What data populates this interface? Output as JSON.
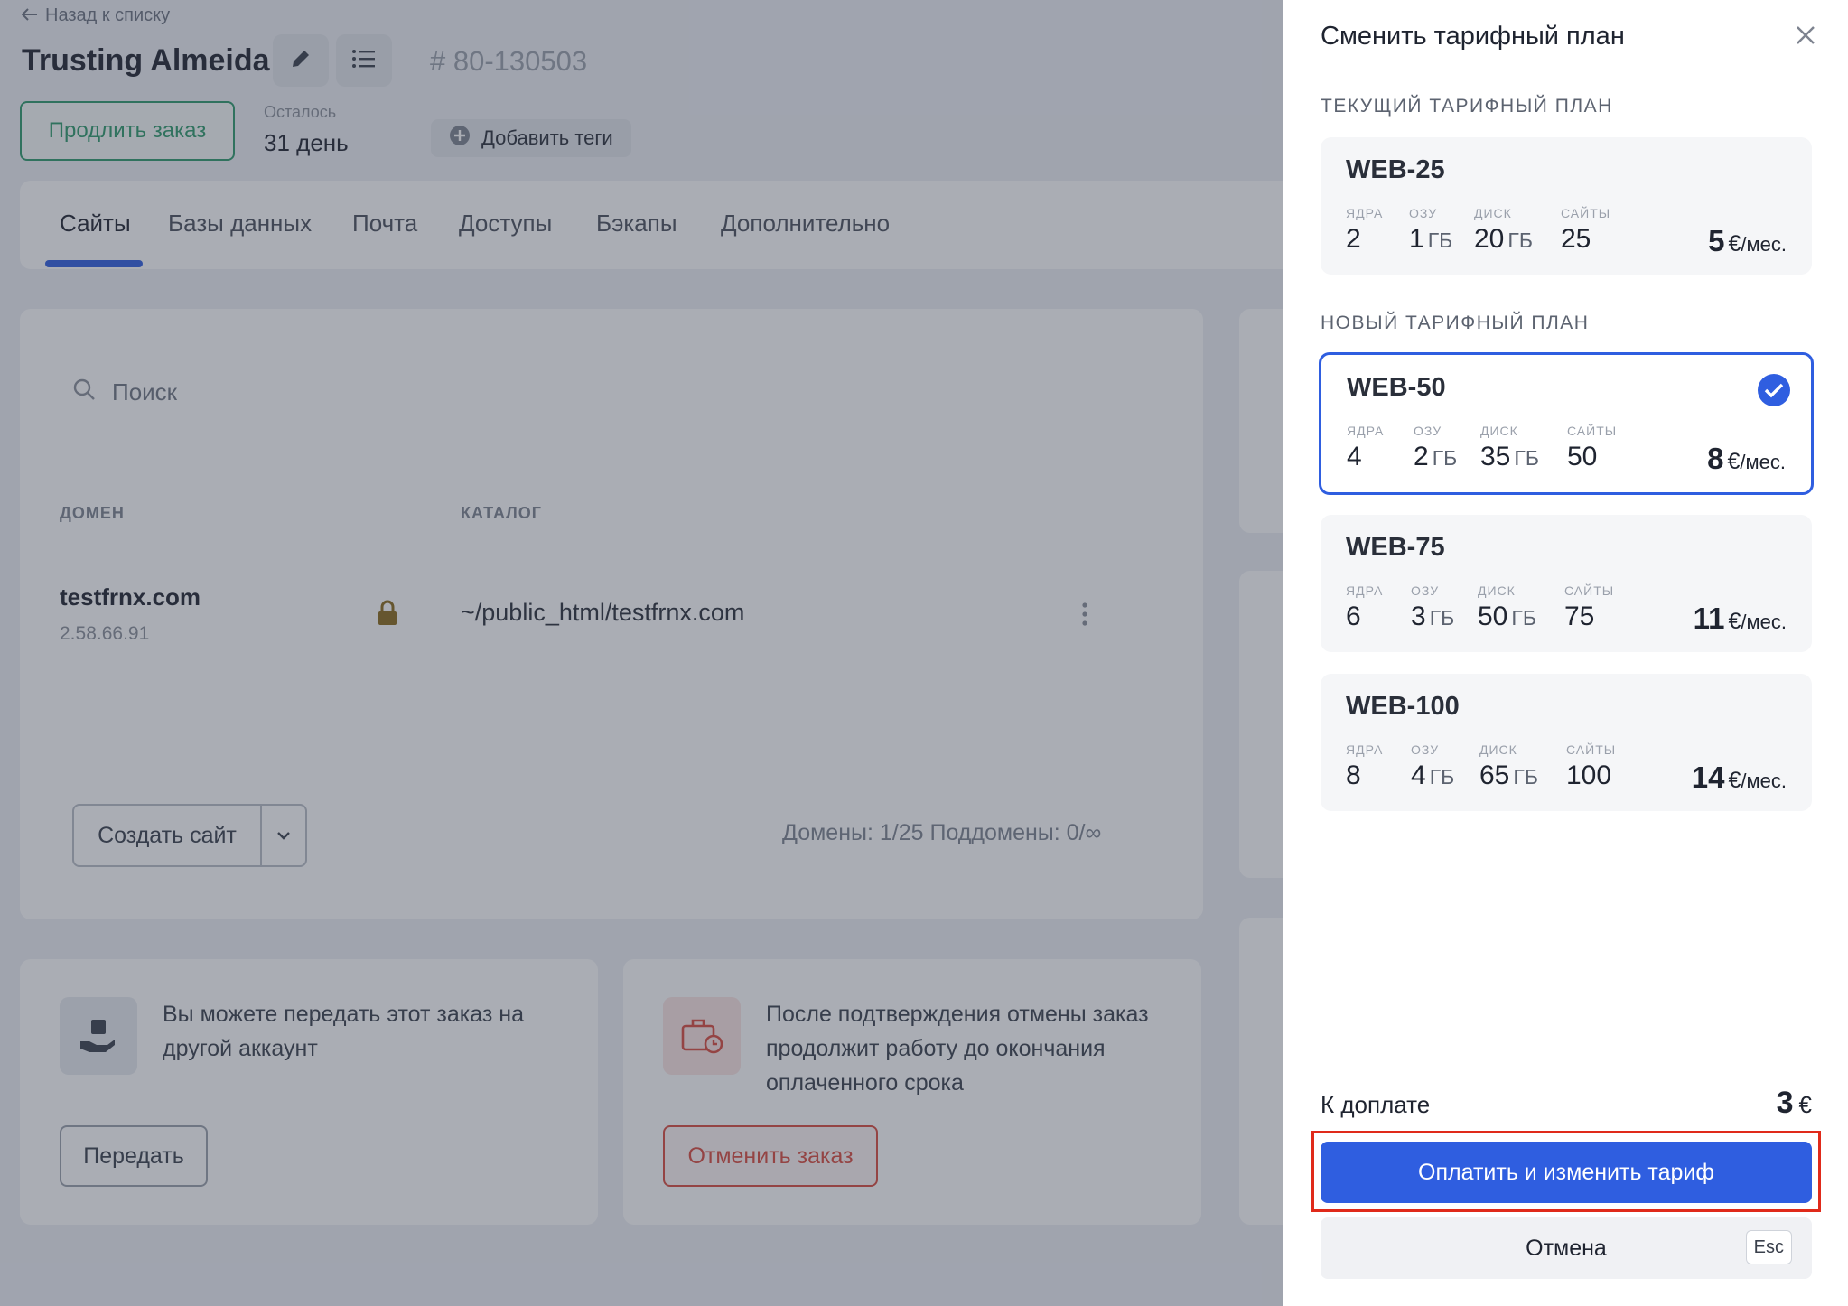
{
  "header": {
    "back_link": "Назад к списку",
    "title": "Trusting Almeida",
    "order_id": "# 80-130503",
    "extend_button": "Продлить заказ",
    "remaining_label": "Осталось",
    "remaining_value": "31 день",
    "add_tags_button": "Добавить теги"
  },
  "tabs": [
    {
      "label": "Сайты",
      "active": true
    },
    {
      "label": "Базы данных"
    },
    {
      "label": "Почта"
    },
    {
      "label": "Доступы"
    },
    {
      "label": "Бэкапы"
    },
    {
      "label": "Дополнительно"
    }
  ],
  "sites": {
    "search_placeholder": "Поиск",
    "columns": [
      "ДОМЕН",
      "КАТАЛОГ"
    ],
    "rows": [
      {
        "domain": "testfrnx.com",
        "ip": "2.58.66.91",
        "catalog": "~/public_html/testfrnx.com"
      }
    ],
    "create_button": "Создать сайт",
    "counts": "Домены: 1/25   Поддомены: 0/∞"
  },
  "transfer_card": {
    "text": "Вы можете передать этот заказ на другой аккаунт",
    "button": "Передать"
  },
  "cancel_card": {
    "text": "После подтверждения отмены заказ продолжит работу до окончания оплаченного срока",
    "button": "Отменить заказ"
  },
  "modal": {
    "title": "Сменить тарифный план",
    "current_label": "ТЕКУЩИЙ ТАРИФНЫЙ ПЛАН",
    "new_label": "НОВЫЙ ТАРИФНЫЙ ПЛАН",
    "spec_labels": {
      "cores": "ЯДРА",
      "ram": "ОЗУ",
      "disk": "ДИСК",
      "sites": "САЙТЫ"
    },
    "unit": "ГБ",
    "currency": "€",
    "per": "/мес.",
    "current_plan": {
      "name": "WEB-25",
      "cores": "2",
      "ram": "1",
      "disk": "20",
      "sites": "25",
      "price": "5"
    },
    "plans": [
      {
        "name": "WEB-50",
        "cores": "4",
        "ram": "2",
        "disk": "35",
        "sites": "50",
        "price": "8",
        "selected": true
      },
      {
        "name": "WEB-75",
        "cores": "6",
        "ram": "3",
        "disk": "50",
        "sites": "75",
        "price": "11"
      },
      {
        "name": "WEB-100",
        "cores": "8",
        "ram": "4",
        "disk": "65",
        "sites": "100",
        "price": "14"
      }
    ],
    "due_label": "К доплате",
    "due_value": "3",
    "pay_button": "Оплатить и изменить тариф",
    "cancel_button": "Отмена",
    "esc_key": "Esc"
  },
  "colors": {
    "accent": "#2f5ee0",
    "green": "#2e9a6b",
    "danger": "#d94b3f",
    "highlight_frame": "#e02a1a"
  }
}
